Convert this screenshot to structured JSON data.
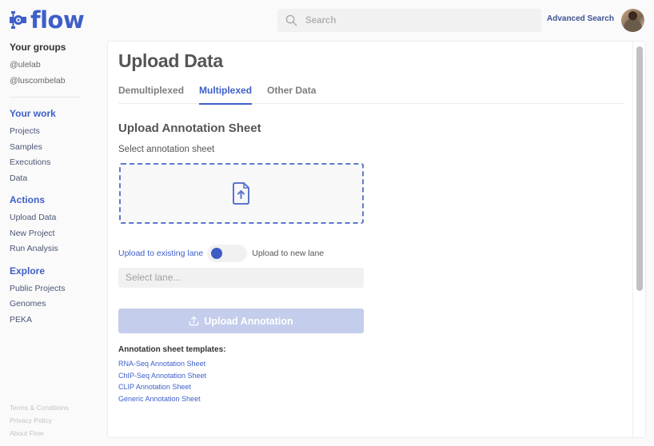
{
  "app": {
    "name": "flow",
    "brand_color": "#3e5fc9"
  },
  "header": {
    "search_placeholder": "Search",
    "advanced_search": "Advanced Search",
    "avatar_alt": "User avatar"
  },
  "sidebar": {
    "groups_heading": "Your groups",
    "groups": [
      "@ulelab",
      "@luscombelab"
    ],
    "your_work": {
      "heading": "Your work",
      "items": [
        "Projects",
        "Samples",
        "Executions",
        "Data"
      ]
    },
    "actions": {
      "heading": "Actions",
      "items": [
        "Upload Data",
        "New Project",
        "Run Analysis"
      ]
    },
    "explore": {
      "heading": "Explore",
      "items": [
        "Public Projects",
        "Genomes",
        "PEKA"
      ]
    },
    "footer": [
      "Terms & Conditions",
      "Privacy Policy",
      "About Flow"
    ]
  },
  "main": {
    "title": "Upload Data",
    "tabs": [
      {
        "label": "Demultiplexed",
        "active": false
      },
      {
        "label": "Multiplexed",
        "active": true
      },
      {
        "label": "Other Data",
        "active": false
      }
    ],
    "section_title": "Upload Annotation Sheet",
    "select_label": "Select annotation sheet",
    "dropzone_icon": "file-upload-icon",
    "toggle": {
      "left_label": "Upload to existing lane",
      "right_label": "Upload to new lane",
      "state": "existing"
    },
    "lane_select_placeholder": "Select lane...",
    "upload_button": "Upload Annotation",
    "templates_title": "Annotation sheet templates:",
    "templates": [
      "RNA-Seq Annotation Sheet",
      "ChIP-Seq Annotation Sheet",
      "CLIP Annotation Sheet",
      "Generic Annotation Sheet"
    ]
  }
}
